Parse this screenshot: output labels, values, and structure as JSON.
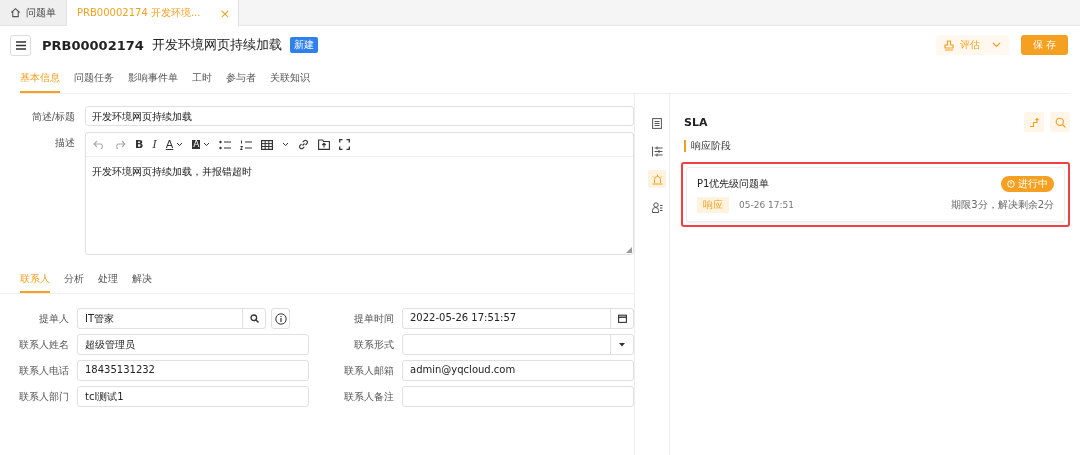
{
  "tabs": [
    {
      "label": "问题单",
      "kind": "home",
      "selected": false
    },
    {
      "label": "PRB00002174 开发环境...",
      "kind": "record",
      "close": "×",
      "selected": true
    }
  ],
  "header": {
    "number": "PRB00002174",
    "title": "开发环境网页持续加载",
    "status": "新建",
    "assess": "评估",
    "save": "保 存"
  },
  "nav_tabs": [
    {
      "label": "基本信息",
      "selected": true
    },
    {
      "label": "问题任务",
      "selected": false
    },
    {
      "label": "影响事件单",
      "selected": false
    },
    {
      "label": "工时",
      "selected": false
    },
    {
      "label": "参与者",
      "selected": false
    },
    {
      "label": "关联知识",
      "selected": false
    }
  ],
  "summary": {
    "label": "简述/标题",
    "value": "开发环境网页持续加载"
  },
  "description": {
    "label": "描述",
    "toolbar_glyphs": [
      "B",
      "I",
      "A",
      "A"
    ],
    "value": "开发环境网页持续加载，并报错超时"
  },
  "sub_tabs": [
    {
      "label": "联系人",
      "selected": true
    },
    {
      "label": "分析",
      "selected": false
    },
    {
      "label": "处理",
      "selected": false
    },
    {
      "label": "解决",
      "selected": false
    }
  ],
  "contact_fields": [
    {
      "label": "提单人",
      "value": "IT管家",
      "kind": "lookup"
    },
    {
      "label": "提单时间",
      "value": "2022-05-26 17:51:57",
      "kind": "date"
    },
    {
      "label": "联系人姓名",
      "value": "超级管理员",
      "kind": "text"
    },
    {
      "label": "联系形式",
      "kind": "select"
    },
    {
      "label": "联系人电话",
      "value": "18435131232",
      "kind": "text"
    },
    {
      "label": "联系人邮箱",
      "value": "admin@yqcloud.com",
      "kind": "text"
    },
    {
      "label": "联系人部门",
      "value": "tcl测试1",
      "kind": "text"
    },
    {
      "label": "联系人备注",
      "kind": "text"
    }
  ],
  "side_icons": [
    {
      "kind": "document",
      "selected": false
    },
    {
      "kind": "list",
      "selected": false
    },
    {
      "kind": "alarm",
      "selected": true
    },
    {
      "kind": "people",
      "selected": false
    }
  ],
  "sla": {
    "title": "SLA",
    "stage": "响应阶段",
    "cards": [
      {
        "name": "P1优先级问题单",
        "status": "进行中",
        "phase": "响应",
        "time": "05-26 17:51",
        "remaining": "期限3分，解决剩余2分",
        "highlighted": true
      }
    ]
  }
}
